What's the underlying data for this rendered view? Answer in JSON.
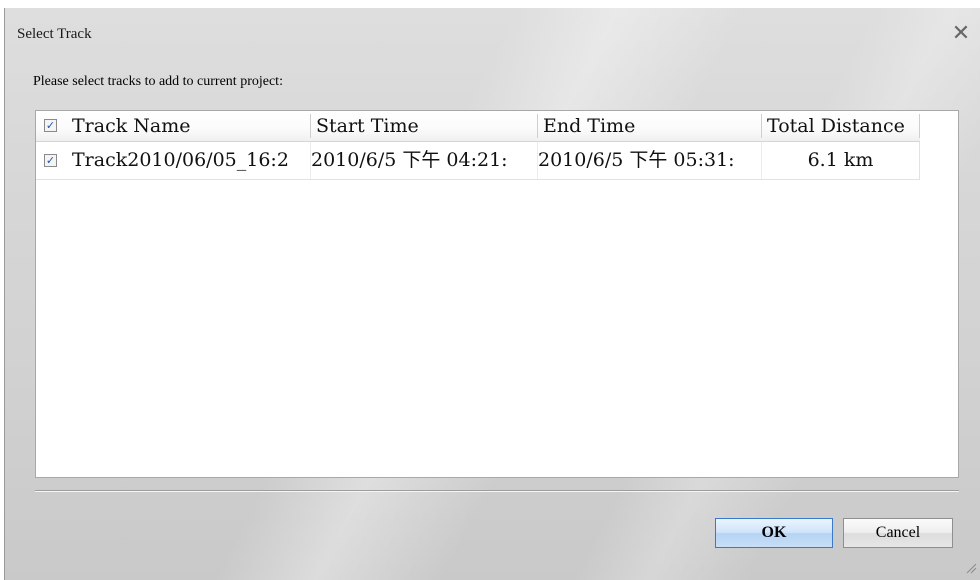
{
  "window": {
    "title": "Select Track",
    "close_symbol": "✕"
  },
  "prompt": "Please select tracks to add to current project:",
  "table": {
    "select_all_checked": true,
    "columns": [
      {
        "label": "Track Name"
      },
      {
        "label": "Start Time"
      },
      {
        "label": "End Time"
      },
      {
        "label": "Total Distance"
      }
    ],
    "rows": [
      {
        "checked": true,
        "track_name": "Track2010/06/05_16:2",
        "start_time": "2010/6/5 下午 04:21:",
        "end_time": "2010/6/5 下午 05:31:",
        "total_distance": "6.1 km"
      }
    ]
  },
  "buttons": {
    "ok": "OK",
    "cancel": "Cancel"
  },
  "icons": {
    "check": "✓",
    "close": "close-icon",
    "resize_grip": "resize-grip-icon"
  },
  "colors": {
    "ok_border": "#3a78c9",
    "check_color": "#2255aa"
  }
}
